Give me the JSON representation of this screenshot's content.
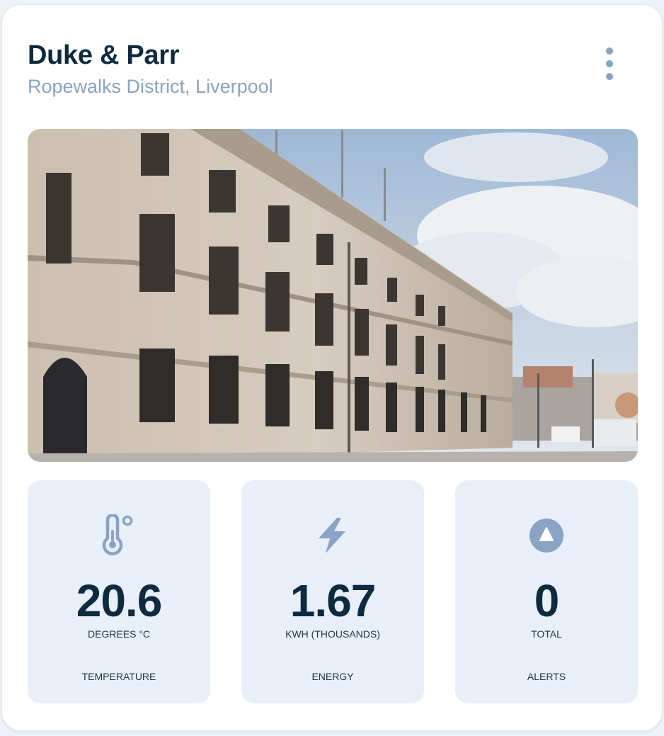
{
  "card": {
    "title": "Duke & Parr",
    "subtitle": "Ropewalks District, Liverpool"
  },
  "colors": {
    "title": "#0d2a3f",
    "subtitle": "#8aa3c4",
    "tile_background": "#e9eff8",
    "icon": "#8aa3c4"
  },
  "metrics": [
    {
      "icon": "thermometer-icon",
      "value": "20.6",
      "unit": "DEGREES °C",
      "label": "TEMPERATURE"
    },
    {
      "icon": "lightning-bolt-icon",
      "value": "1.67",
      "unit": "KWH (THOUSANDS)",
      "label": "ENERGY"
    },
    {
      "icon": "alert-triangle-icon",
      "value": "0",
      "unit": "TOTAL",
      "label": "ALERTS"
    }
  ]
}
